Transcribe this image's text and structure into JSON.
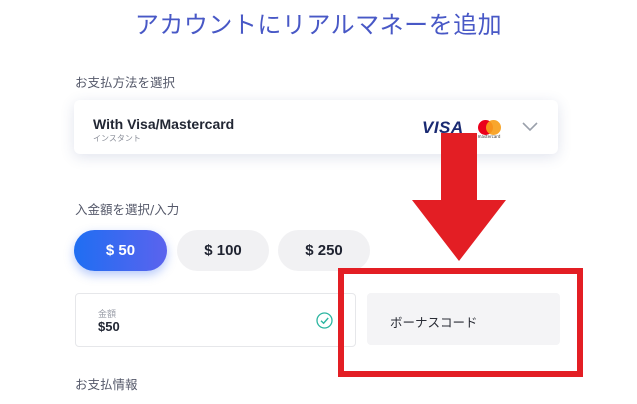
{
  "page": {
    "title": "アカウントにリアルマネーを追加"
  },
  "payment": {
    "label": "お支払方法を選択",
    "method_name": "With Visa/Mastercard",
    "method_sub": "インスタント",
    "visa_text": "VISA",
    "mastercard_text": "mastercard"
  },
  "deposit": {
    "label": "入金額を選択/入力",
    "options": [
      "$ 50",
      "$ 100",
      "$ 250"
    ],
    "selected_index": 0,
    "amount_label": "金額",
    "amount_value": "$50"
  },
  "bonus": {
    "placeholder": "ボーナスコード"
  },
  "payment_info": {
    "label": "お支払情報"
  },
  "annotation": {
    "color": "#e31e24"
  },
  "colors": {
    "accent_start": "#1f6ef2",
    "accent_end": "#5b63ee",
    "title": "#4858c6",
    "check": "#2bb5a0"
  }
}
